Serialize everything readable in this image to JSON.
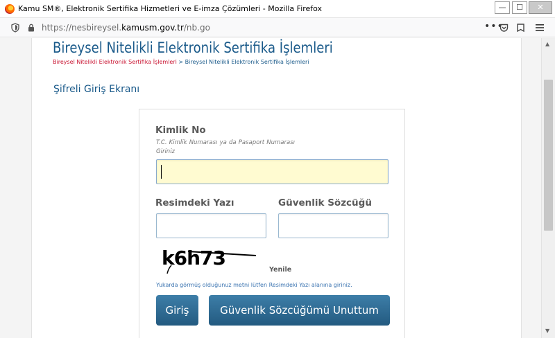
{
  "window": {
    "title": "Kamu SM®, Elektronik Sertifika Hizmetleri ve E-imza Çözümleri - Mozilla Firefox",
    "min_glyph": "—",
    "max_glyph": "☐",
    "close_glyph": "✕"
  },
  "navbar": {
    "url_prefix": "https://nesbireysel.",
    "url_domain": "kamusm.gov.tr",
    "url_path": "/nb.go",
    "more_glyph": "•••"
  },
  "page": {
    "title": "Bireysel Nitelikli Elektronik Sertifika İşlemleri",
    "breadcrumb": {
      "first": "Bireysel Nitelikli Elektronik Sertifika İşlemleri",
      "separator": " > ",
      "second": "Bireysel Nitelikli Elektronik Sertifika İşlemleri"
    },
    "section_title": "Şifreli Giriş Ekranı"
  },
  "form": {
    "kimlik_label": "Kimlik No",
    "kimlik_hint": "T.C. Kimlik Numarası ya da Pasaport Numarası Giriniz",
    "kimlik_value": "",
    "resim_label": "Resimdeki Yazı",
    "resim_value": "",
    "guvenlik_label": "Güvenlik Sözcüğü",
    "guvenlik_value": "",
    "captcha_text": "k6h73",
    "refresh_label": "Yenile",
    "note": "Yukarda görmüş olduğunuz metni lütfen Resimdeki Yazı alanına giriniz.",
    "login_button": "Giriş",
    "forgot_button": "Güvenlik Sözcüğümü Unuttum"
  },
  "scrollbar": {
    "up_glyph": "▲",
    "down_glyph": "▼"
  },
  "colors": {
    "brand_blue": "#1a5a8a",
    "breadcrumb_red": "#c8102e",
    "input_focus_bg": "#fffbd1",
    "button_gradient_top": "#3d7ea8",
    "button_gradient_bottom": "#235a80"
  },
  "icons": {
    "browser": "firefox-icon",
    "tracking": "shield-icon",
    "security": "lock-icon",
    "pocket": "pocket-icon",
    "extensions": "puzzle-icon",
    "menu": "hamburger-menu-icon"
  }
}
